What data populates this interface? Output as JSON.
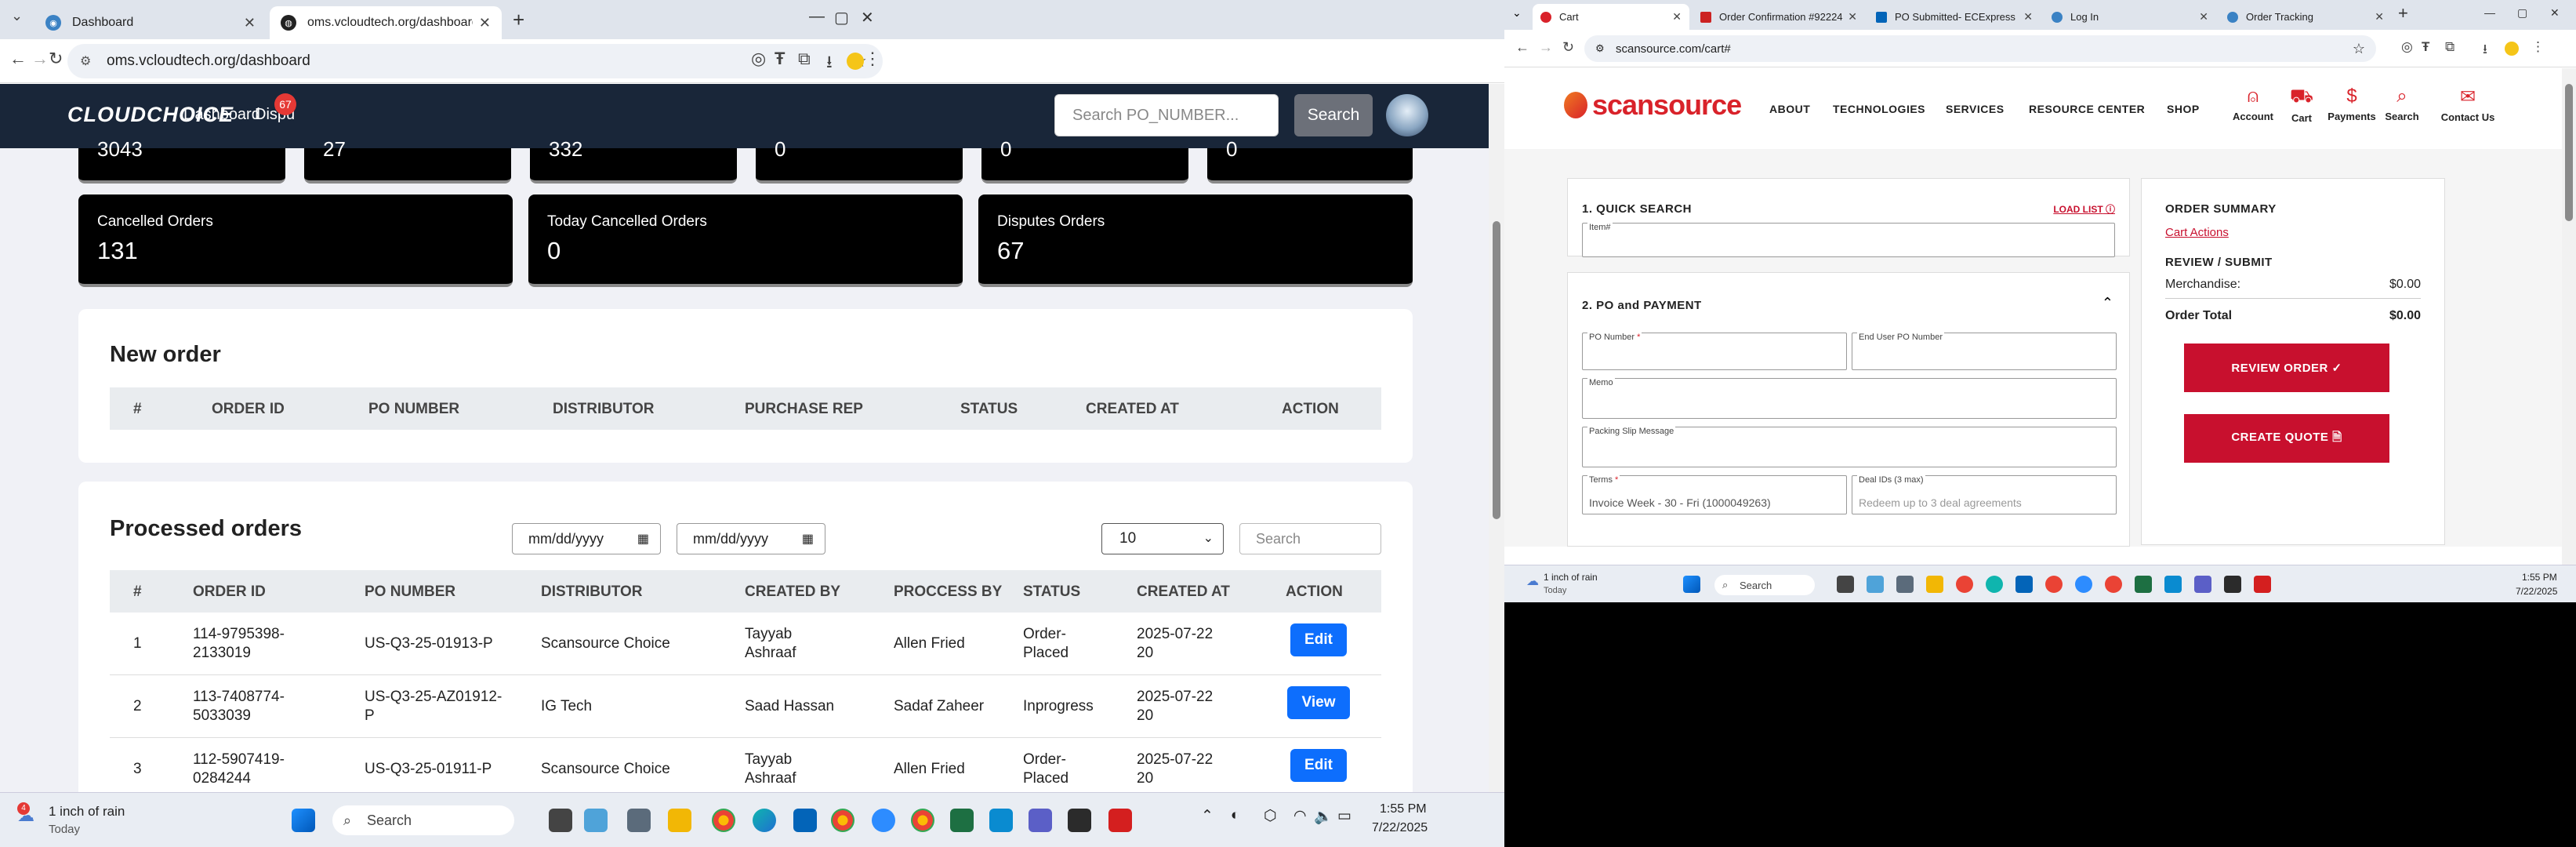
{
  "left_browser": {
    "tabs": [
      {
        "title": "Dashboard",
        "active": false
      },
      {
        "title": "oms.vcloudtech.org/dashboard",
        "active": true
      }
    ],
    "url": "oms.vcloudtech.org/dashboard"
  },
  "app": {
    "logo": "CLOUDCHOICE",
    "nav": {
      "dashboard": "Dashboard",
      "disputes": "Dispu",
      "disputes_badge": "67"
    },
    "search_placeholder": "Search PO_NUMBER...",
    "search_button": "Search",
    "stats_top_partial": [
      "3043",
      "27",
      "332",
      "0",
      "0",
      "0"
    ],
    "stats": [
      {
        "label": "Cancelled Orders",
        "value": "131"
      },
      {
        "label": "Today Cancelled Orders",
        "value": "0"
      },
      {
        "label": "Disputes Orders",
        "value": "67"
      }
    ],
    "new_order": {
      "title": "New order",
      "columns": [
        "#",
        "ORDER ID",
        "PO NUMBER",
        "DISTRIBUTOR",
        "PURCHASE REP",
        "STATUS",
        "CREATED AT",
        "ACTION"
      ]
    },
    "processed": {
      "title": "Processed orders",
      "date_placeholder": "mm/dd/yyyy",
      "page_size": "10",
      "search_placeholder": "Search",
      "columns": [
        "#",
        "ORDER ID",
        "PO NUMBER",
        "DISTRIBUTOR",
        "CREATED BY",
        "PROCCESS BY",
        "STATUS",
        "CREATED AT",
        "ACTION"
      ],
      "rows": [
        {
          "n": "1",
          "order_id": [
            "114-9795398-",
            "2133019"
          ],
          "po": [
            "US-Q3-25-01913-P"
          ],
          "distributor": "Scansource Choice",
          "created_by": [
            "Tayyab",
            "Ashraaf"
          ],
          "process_by": "Allen Fried",
          "status": [
            "Order-",
            "Placed"
          ],
          "created_at": [
            "2025-07-22",
            "20"
          ],
          "action": "Edit"
        },
        {
          "n": "2",
          "order_id": [
            "113-7408774-",
            "5033039"
          ],
          "po": [
            "US-Q3-25-AZ01912-",
            "P"
          ],
          "distributor": "IG Tech",
          "created_by": [
            "Saad Hassan"
          ],
          "process_by": "Sadaf Zaheer",
          "status": [
            "Inprogress"
          ],
          "created_at": [
            "2025-07-22",
            "20"
          ],
          "action": "View"
        },
        {
          "n": "3",
          "order_id": [
            "112-5907419-",
            "0284244"
          ],
          "po": [
            "US-Q3-25-01911-P"
          ],
          "distributor": "Scansource Choice",
          "created_by": [
            "Tayyab",
            "Ashraaf"
          ],
          "process_by": "Allen Fried",
          "status": [
            "Order-",
            "Placed"
          ],
          "created_at": [
            "2025-07-22",
            "20"
          ],
          "action": "Edit"
        }
      ]
    }
  },
  "left_taskbar": {
    "weather": "1 inch of rain",
    "weather_sub": "Today",
    "search": "Search",
    "time": "1:55 PM",
    "date": "7/22/2025"
  },
  "right_browser": {
    "tabs": [
      {
        "title": "Cart",
        "active": true
      },
      {
        "title": "Order Confirmation #92224...",
        "active": false
      },
      {
        "title": "PO Submitted- ECExpress -",
        "active": false
      },
      {
        "title": "Log In",
        "active": false
      },
      {
        "title": "Order Tracking",
        "active": false
      }
    ],
    "url": "scansource.com/cart#"
  },
  "scansource": {
    "logo": "scansource",
    "nav": [
      "ABOUT",
      "TECHNOLOGIES",
      "SERVICES",
      "RESOURCE CENTER",
      "SHOP"
    ],
    "icons": [
      "Account",
      "Cart",
      "Payments",
      "Search",
      "Contact Us"
    ],
    "quick_search": {
      "title": "1. QUICK SEARCH",
      "load_list": "LOAD LIST",
      "item_label": "Item#"
    },
    "po_payment": {
      "title": "2. PO and PAYMENT",
      "po_number": "PO Number",
      "end_user_po": "End User PO Number",
      "memo": "Memo",
      "packing": "Packing Slip Message",
      "terms": "Terms",
      "terms_value": "Invoice Week - 30 - Fri (1000049263)",
      "deal_ids": "Deal IDs (3 max)",
      "deal_placeholder": "Redeem up to 3 deal agreements"
    },
    "summary": {
      "title": "ORDER SUMMARY",
      "cart_actions": "Cart Actions",
      "review_submit": "REVIEW / SUBMIT",
      "merch_label": "Merchandise:",
      "merch_value": "$0.00",
      "total_label": "Order Total",
      "total_value": "$0.00",
      "review_btn": "REVIEW ORDER ✓",
      "quote_btn": "CREATE QUOTE 🗎"
    }
  },
  "right_taskbar": {
    "weather": "1 inch of rain",
    "weather_sub": "Today",
    "search": "Search",
    "time": "1:55 PM",
    "date": "7/22/2025"
  },
  "colors": {
    "nav_dark": "#192639",
    "stat_bg": "#000000",
    "primary_btn": "#0d6efd",
    "scansource_red": "#c8102e"
  }
}
